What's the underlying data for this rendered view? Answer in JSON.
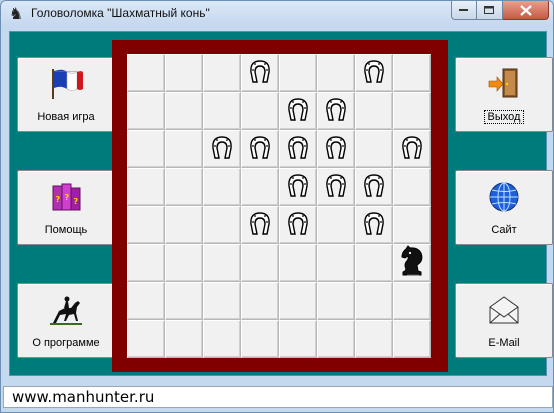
{
  "window": {
    "title": "Головоломка \"Шахматный конь\""
  },
  "left_buttons": [
    {
      "name": "new-game-button",
      "label": "Новая игра",
      "icon": "flag-icon"
    },
    {
      "name": "help-button",
      "label": "Помощь",
      "icon": "books-icon"
    },
    {
      "name": "about-button",
      "label": "О программе",
      "icon": "horse-rider-icon"
    }
  ],
  "right_buttons": [
    {
      "name": "exit-button",
      "label": "Выход",
      "icon": "exit-door-icon"
    },
    {
      "name": "site-button",
      "label": "Сайт",
      "icon": "globe-icon"
    },
    {
      "name": "email-button",
      "label": "E-Mail",
      "icon": "envelope-icon"
    }
  ],
  "board": {
    "size": 8,
    "horseshoes": [
      [
        0,
        3
      ],
      [
        0,
        6
      ],
      [
        1,
        4
      ],
      [
        1,
        5
      ],
      [
        2,
        2
      ],
      [
        2,
        3
      ],
      [
        2,
        4
      ],
      [
        2,
        5
      ],
      [
        2,
        7
      ],
      [
        3,
        4
      ],
      [
        3,
        5
      ],
      [
        3,
        6
      ],
      [
        4,
        3
      ],
      [
        4,
        4
      ],
      [
        4,
        6
      ]
    ],
    "knight": [
      5,
      7
    ]
  },
  "status": {
    "text": "www.manhunter.ru"
  }
}
